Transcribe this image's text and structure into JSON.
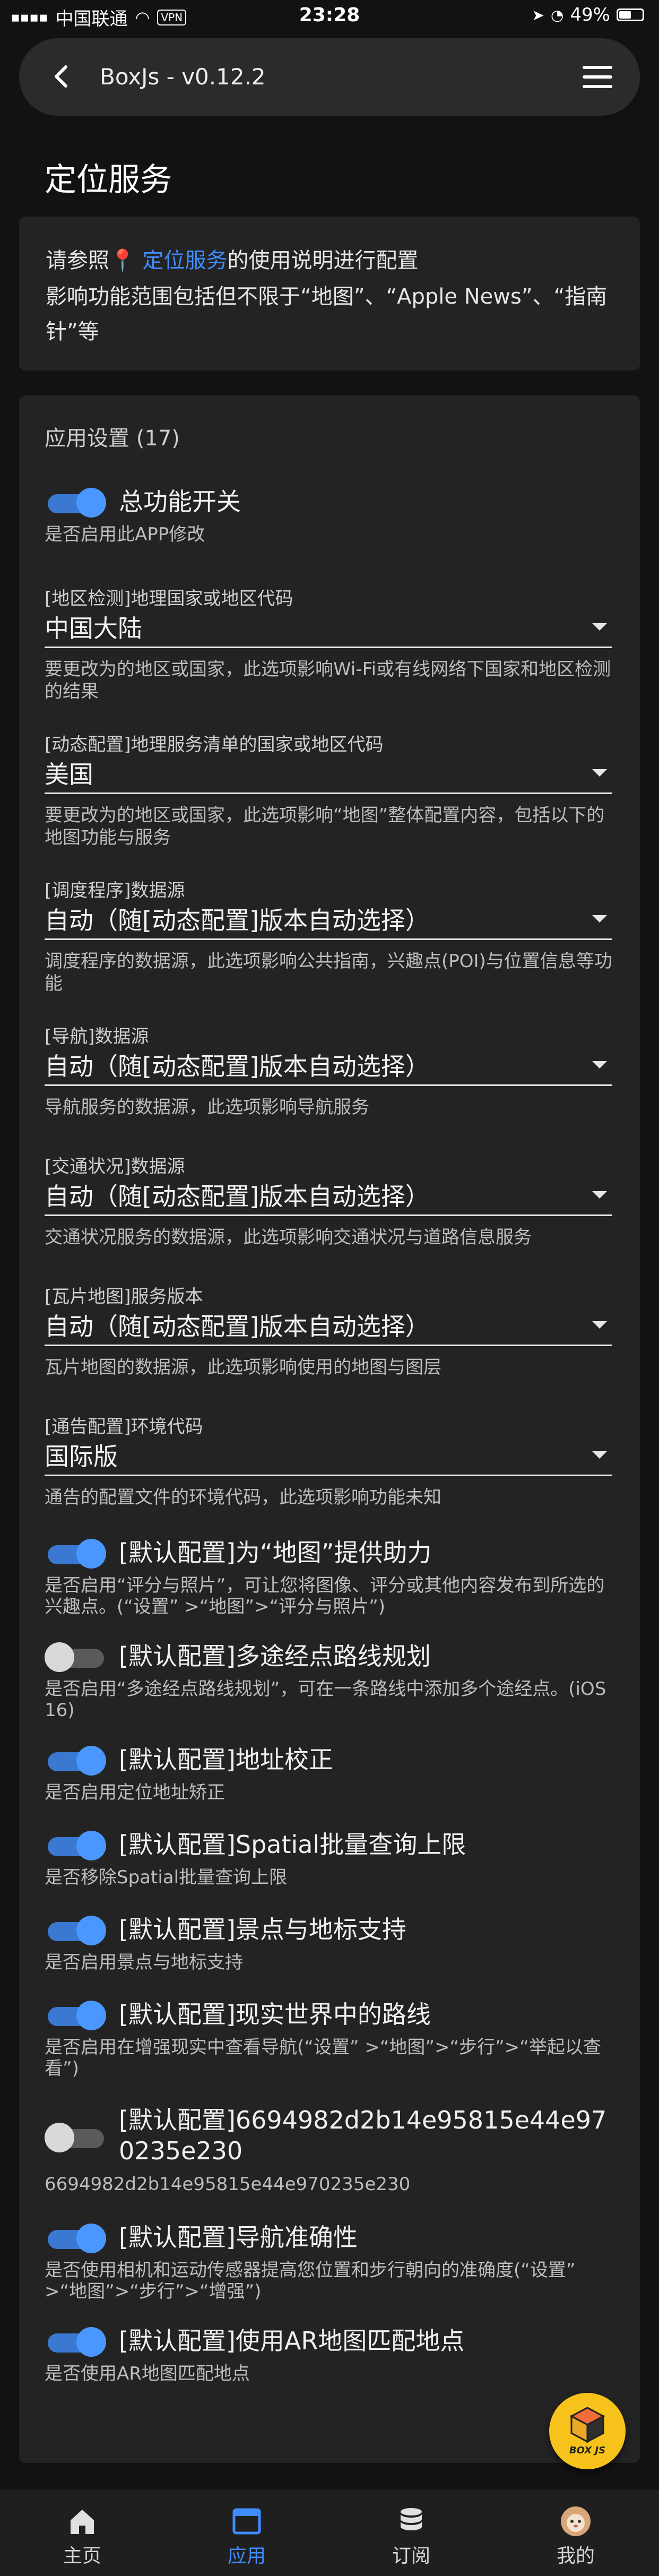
{
  "status_bar": {
    "carrier": "中国联通",
    "vpn": "VPN",
    "time": "23:28",
    "battery": "49%",
    "battery_level": 0.49
  },
  "header": {
    "title": "BoxJs - v0.12.2",
    "back_icon": "chevron-left-icon",
    "menu_icon": "hamburger-icon"
  },
  "page_title": "定位服务",
  "intro": {
    "prefix": "请参照",
    "pin_icon": "📍",
    "link_text": "定位服务",
    "suffix": "的使用说明进行配置",
    "line2": "影响功能范围包括但不限于“地图”、“Apple News”、“指南针”等"
  },
  "settings": {
    "title": "应用设置 (17)",
    "master_switch": {
      "label": "总功能开关",
      "on": true,
      "desc": "是否启用此APP修改"
    },
    "fields": [
      {
        "label": "[地区检测]地理国家或地区代码",
        "value": "中国大陆",
        "desc": "要更改为的地区或国家，此选项影响Wi-Fi或有线网络下国家和地区检测的结果"
      },
      {
        "label": "[动态配置]地理服务清单的国家或地区代码",
        "value": "美国",
        "desc": "要更改为的地区或国家，此选项影响“地图”整体配置内容，包括以下的地图功能与服务"
      },
      {
        "label": "[调度程序]数据源",
        "value": "自动（随[动态配置]版本自动选择）",
        "desc": "调度程序的数据源，此选项影响公共指南，兴趣点(POI)与位置信息等功能"
      },
      {
        "label": "[导航]数据源",
        "value": "自动（随[动态配置]版本自动选择）",
        "desc": "导航服务的数据源，此选项影响导航服务"
      },
      {
        "label": "[交通状况]数据源",
        "value": "自动（随[动态配置]版本自动选择）",
        "desc": "交通状况服务的数据源，此选项影响交通状况与道路信息服务"
      },
      {
        "label": "[瓦片地图]服务版本",
        "value": "自动（随[动态配置]版本自动选择）",
        "desc": "瓦片地图的数据源，此选项影响使用的地图与图层"
      },
      {
        "label": "[通告配置]环境代码",
        "value": "国际版",
        "desc": "通告的配置文件的环境代码，此选项影响功能未知"
      }
    ],
    "switches": [
      {
        "label": "[默认配置]为“地图”提供助力",
        "on": true,
        "desc": "是否启用“评分与照片”，可让您将图像、评分或其他内容发布到所选的兴趣点。(“设置” >“地图”>“评分与照片”)"
      },
      {
        "label": "[默认配置]多途经点路线规划",
        "on": false,
        "desc": "是否启用“多途经点路线规划”，可在一条路线中添加多个途经点。(iOS 16)"
      },
      {
        "label": "[默认配置]地址校正",
        "on": true,
        "desc": "是否启用定位地址矫正"
      },
      {
        "label": "[默认配置]Spatial批量查询上限",
        "on": true,
        "desc": "是否移除Spatial批量查询上限"
      },
      {
        "label": "[默认配置]景点与地标支持",
        "on": true,
        "desc": "是否启用景点与地标支持"
      },
      {
        "label": "[默认配置]现实世界中的路线",
        "on": true,
        "desc": "是否启用在增强现实中查看导航(“设置” >“地图”>“步行”>“举起以查看”)"
      },
      {
        "label": "[默认配置]6694982d2b14e95815e44e970235e230",
        "on": false,
        "desc": "6694982d2b14e95815e44e970235e230"
      },
      {
        "label": "[默认配置]导航准确性",
        "on": true,
        "desc": "是否使用相机和运动传感器提高您位置和步行朝向的准确度(“设置” >“地图”>“步行”>“增强”)"
      },
      {
        "label": "[默认配置]使用AR地图匹配地点",
        "on": true,
        "desc": "是否使用AR地图匹配地点"
      }
    ]
  },
  "fab": {
    "text": "BOX JS",
    "icon": "boxjs-logo-icon"
  },
  "bottom_nav": [
    {
      "label": "主页",
      "icon": "home-icon",
      "active": false
    },
    {
      "label": "应用",
      "icon": "app-window-icon",
      "active": true
    },
    {
      "label": "订阅",
      "icon": "database-icon",
      "active": false
    },
    {
      "label": "我的",
      "icon": "avatar-icon",
      "active": false
    }
  ],
  "colors": {
    "accent": "#3f8cff",
    "switch_on": "#4a98ff",
    "background": "#121212",
    "card": "#232323",
    "fab": "#f7c31a"
  }
}
